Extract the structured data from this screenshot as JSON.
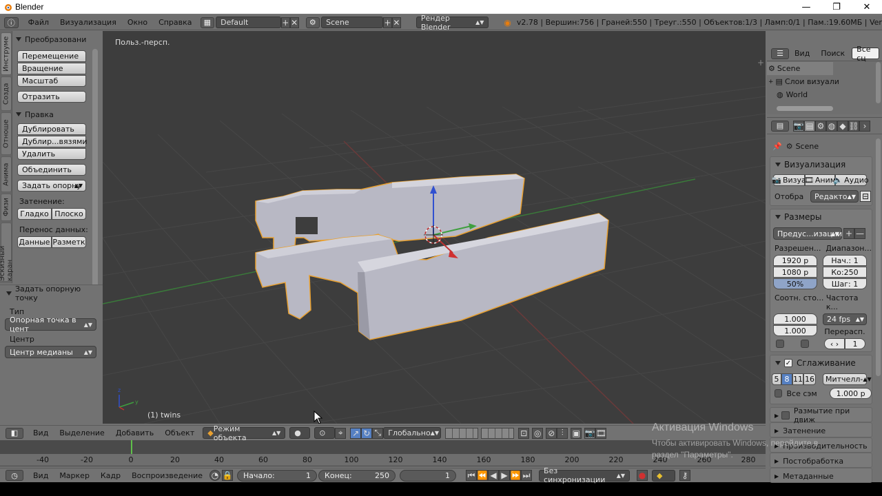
{
  "window": {
    "title": "Blender",
    "minimize": "—",
    "maximize": "❐",
    "close": "✕"
  },
  "topbar": {
    "menus": [
      "Файл",
      "Визуализация",
      "Окно",
      "Справка"
    ],
    "layout": "Default",
    "scene": "Scene",
    "engine": "Рендер Blender",
    "stats": "v2.78 | Вершин:756 | Граней:550 | Треуг.:550 | Объектов:1/3 | Ламп:0/1 | Пам.:19.60МБ | Ver"
  },
  "toolshelf": {
    "tabs": [
      "Инструме",
      "Созда",
      "Отноше",
      "Анима",
      "Физи",
      "Эскизный каран"
    ],
    "transform_head": "Преобразовани",
    "translate": "Перемещение",
    "rotate": "Вращение",
    "scale": "Масштаб",
    "mirror": "Отразить",
    "edit_head": "Правка",
    "duplicate": "Дублировать",
    "duplicate_linked": "Дублир...вязями",
    "delete": "Удалить",
    "join": "Объединить",
    "set_origin": "Задать опорну",
    "shading_label": "Затенение:",
    "smooth": "Гладко",
    "flat": "Плоско",
    "data_transfer_label": "Перенос данных:",
    "data": "Данные",
    "layout_btn": "Разметк"
  },
  "operator_panel": {
    "head": "Задать опорную точку",
    "type_label": "Тип",
    "type_value": "Опорная точка в цент",
    "center_label": "Центр",
    "center_value": "Центр медианы"
  },
  "viewport": {
    "mode_label": "Польз.-персп.",
    "object_label": "(1) twins"
  },
  "view3d_header": {
    "view": "Вид",
    "select": "Выделение",
    "add": "Добавить",
    "object": "Объект",
    "mode": "Режим объекта",
    "orientation": "Глобально"
  },
  "timeline": {
    "ticks": [
      "-40",
      "-20",
      "0",
      "20",
      "40",
      "60",
      "80",
      "100",
      "120",
      "140",
      "160",
      "180",
      "200",
      "220",
      "240",
      "260",
      "280"
    ],
    "current_frame_marker": 0,
    "footer": {
      "view": "Вид",
      "marker": "Маркер",
      "frame": "Кадр",
      "playback": "Воспроизведение",
      "start_label": "Начало:",
      "start_value": "1",
      "end_label": "Конец:",
      "end_value": "250",
      "current": "1",
      "sync": "Без синхронизации"
    }
  },
  "outliner": {
    "view": "Вид",
    "search": "Поиск",
    "filter": "Все сц",
    "rows": [
      "Scene",
      "Слои визуали",
      "World"
    ]
  },
  "properties": {
    "context": "Scene",
    "render_head": "Визуализация",
    "render_btns": [
      "Визуа",
      "Аним",
      "Аудио"
    ],
    "display_label": "Отобра",
    "display_value": "Редакто...",
    "dimensions_head": "Размеры",
    "preset": "Предус...изации",
    "resolution_label": "Разрешен...",
    "range_label": "Диапазон...",
    "res_x": "1920 р",
    "res_y": "1080 р",
    "res_pct": "50%",
    "start": "Нач.: 1",
    "end": "Ко:250",
    "step": "Шаг: 1",
    "aspect_label": "Соотн. сто...",
    "fps_label": "Частота к...",
    "aspect_x": "1.000",
    "aspect_y": "1.000",
    "fps": "24 fps",
    "remap_label": "Перерасп.",
    "remap_value": "1",
    "aa_head": "Сглаживание",
    "aa_samples": [
      "5",
      "8",
      "11",
      "16"
    ],
    "aa_filter": "Митчелл-",
    "full_sample": "Все сэм",
    "filter_size": "1.000 р",
    "motion_blur": "Размытие при движ",
    "shading": "Затенение",
    "performance": "Производительность",
    "post_processing": "Постобработка",
    "metadata": "Метаданные"
  },
  "watermark": {
    "line1": "Активация Windows",
    "line2": "Чтобы активировать Windows, перейдите в",
    "line3": "раздел \"Параметры\"."
  },
  "colors": {
    "axis_x": "#b03030",
    "axis_y": "#3f9f3f",
    "axis_z": "#3050d0",
    "selection_outline": "#e8a030",
    "mesh": "#b8b8c4",
    "viewport_bg": "#3d3d3d",
    "timeline_cursor": "#5fc04a"
  }
}
